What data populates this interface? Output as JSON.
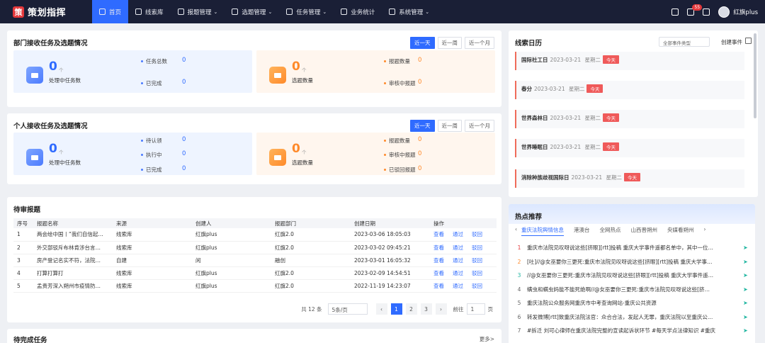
{
  "app": {
    "title": "策划指挥",
    "logo_mark": "策"
  },
  "nav": {
    "items": [
      {
        "label": "首页",
        "active": true,
        "icon": "home-icon"
      },
      {
        "label": "线索库",
        "icon": "library-icon"
      },
      {
        "label": "报题管理",
        "icon": "report-icon",
        "dropdown": true
      },
      {
        "label": "选题管理",
        "icon": "topic-icon",
        "dropdown": true
      },
      {
        "label": "任务管理",
        "icon": "task-icon",
        "dropdown": true
      },
      {
        "label": "业务统计",
        "icon": "stats-icon"
      },
      {
        "label": "系统管理",
        "icon": "system-icon",
        "dropdown": true
      }
    ],
    "arrow": "⌄"
  },
  "user": {
    "name": "红旗plus",
    "badge": "55"
  },
  "dept": {
    "title": "部门接收任务及选题情况",
    "ranges": [
      "近一天",
      "近一周",
      "近一个月"
    ],
    "task": {
      "value": "0",
      "unit": "个",
      "label": "处理中任务数",
      "subs": [
        {
          "label": "任务总数",
          "value": "0"
        },
        {
          "label": "已完成",
          "value": "0"
        }
      ]
    },
    "topic": {
      "value": "0",
      "unit": "个",
      "label": "选题数量",
      "subs": [
        {
          "label": "报题数量",
          "value": "0"
        },
        {
          "label": "审核中报题",
          "value": "0"
        }
      ]
    }
  },
  "personal": {
    "title": "个人接收任务及选题情况",
    "ranges": [
      "近一天",
      "近一周",
      "近一个月"
    ],
    "task": {
      "value": "0",
      "unit": "个",
      "label": "处理中任务数",
      "subs": [
        {
          "label": "待认领",
          "value": "0"
        },
        {
          "label": "执行中",
          "value": "0"
        },
        {
          "label": "已完成",
          "value": "0"
        }
      ]
    },
    "topic": {
      "value": "0",
      "unit": "个",
      "label": "选题数量",
      "subs": [
        {
          "label": "报题数量",
          "value": "0"
        },
        {
          "label": "审核中报题",
          "value": "0"
        },
        {
          "label": "已驳回报题",
          "value": "0"
        }
      ]
    }
  },
  "calendar": {
    "title": "线索日历",
    "filter": "全部事件类型",
    "create": "创建事件",
    "items": [
      {
        "name": "国际社工日",
        "date": "2023-03-21",
        "weekday": "星期二",
        "tag": "今天"
      },
      {
        "name": "春分",
        "date": "2023-03-21",
        "weekday": "星期二",
        "tag": "今天"
      },
      {
        "name": "世界森林日",
        "date": "2023-03-21",
        "weekday": "星期二",
        "tag": "今天"
      },
      {
        "name": "世界睡眠日",
        "date": "2023-03-21",
        "weekday": "星期二",
        "tag": "今天"
      },
      {
        "name": "消除种族歧视国际日",
        "date": "2023-03-21",
        "weekday": "星期二",
        "tag": "今天"
      }
    ]
  },
  "pending": {
    "title": "待审报题",
    "headers": [
      "序号",
      "报题名称",
      "来源",
      "创建人",
      "报题部门",
      "创建日期",
      "操作"
    ],
    "actions": [
      "查看",
      "通过",
      "驳回"
    ],
    "rows": [
      [
        "1",
        "两会绘中国丨“我们自信起…",
        "线索库",
        "红旗plus",
        "红旗2.0",
        "2023-03-06 18:05:03"
      ],
      [
        "2",
        "外交部驳斥布林肯涉台言…",
        "线索库",
        "红旗plus",
        "红旗2.0",
        "2023-03-02 09:45:21"
      ],
      [
        "3",
        "房产登记名实不符，法院…",
        "自建",
        "闲",
        "融创",
        "2023-03-01 16:05:32"
      ],
      [
        "4",
        "打算打算打",
        "线索库",
        "红旗plus",
        "红旗2.0",
        "2023-02-09 14:54:51"
      ],
      [
        "5",
        "孟贵芳深入朔州市疫情防…",
        "线索库",
        "红旗plus",
        "红旗2.0",
        "2022-11-19 14:23:07"
      ]
    ],
    "pager": {
      "total": "共 12 条",
      "page_size": "5条/页",
      "pages": [
        "1",
        "2",
        "3"
      ],
      "prev": "‹",
      "next": "›",
      "goto": "前往",
      "goto_value": "1",
      "page_unit": "页"
    }
  },
  "todo": {
    "title": "待完成任务",
    "more": "更多>"
  },
  "hot": {
    "title": "热点推荐",
    "tabs": [
      "重庆法院舆情信息",
      "港澳台",
      "全网热点",
      "山西晋朔州",
      "央媒看朔州"
    ],
    "prev": "‹",
    "next": "›",
    "send": "➤",
    "items": [
      {
        "rank": "1",
        "text": "重庆市法院见叹呀说这些[挤眼][rtt]投稿 重庆大学事件遥都名单中，其中一位…"
      },
      {
        "rank": "2",
        "text": "[吐]//@女巫要你三更死:重庆市法院见叹呀说这些[挤眼][rtt]投稿 重庆大学事…"
      },
      {
        "rank": "3",
        "text": "//@女巫要你三更死:重庆市法院见叹呀说这些[挤眼][rtt]投稿 重庆大学事件遥…"
      },
      {
        "rank": "4",
        "text": "螨虫和螨虫妈能不能死绝啊//@女巫要你三更死:重庆市法院见叹呀说这些[挤…"
      },
      {
        "rank": "5",
        "text": "重庆法院公众服务网重庆市中考查询网站-重庆公共资源"
      },
      {
        "rank": "6",
        "text": "转发微博[rtt]致重庆法院法官：众合合法，发起人无罪，重庆法院以至重庆公…"
      },
      {
        "rank": "7",
        "text": "#拆迁 刘可心律师在重庆法院完整的宣读起诉状环节 #每天学点法律知识 #重庆"
      }
    ]
  }
}
